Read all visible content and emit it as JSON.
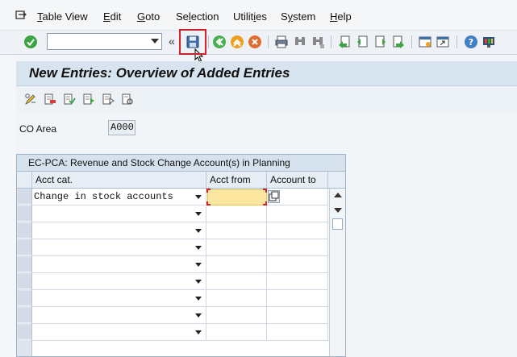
{
  "menu": {
    "items": [
      {
        "pre": "",
        "u": "T",
        "post": "able View"
      },
      {
        "pre": "",
        "u": "E",
        "post": "dit"
      },
      {
        "pre": "",
        "u": "G",
        "post": "oto"
      },
      {
        "pre": "Se",
        "u": "l",
        "post": "ection"
      },
      {
        "pre": "Utilit",
        "u": "i",
        "post": "es"
      },
      {
        "pre": "S",
        "u": "y",
        "post": "stem"
      },
      {
        "pre": "",
        "u": "H",
        "post": "elp"
      }
    ]
  },
  "toolbar": {
    "command_value": "",
    "nav_arrows": "«",
    "icons": [
      "check-icon",
      "save-icon",
      "back-icon",
      "exit-icon",
      "cancel-icon",
      "print-icon",
      "find-icon",
      "find-next-icon",
      "first-page-icon",
      "prev-page-icon",
      "next-page-icon",
      "last-page-icon",
      "create-session-icon",
      "shortcut-icon",
      "help-icon",
      "customize-icon"
    ]
  },
  "page": {
    "title": "New Entries: Overview of Added Entries"
  },
  "co_area": {
    "label": "CO Area",
    "value": "A000"
  },
  "table": {
    "title": "EC-PCA: Revenue and Stock Change Account(s) in Planning",
    "columns": [
      "Acct cat.",
      "Acct from",
      "Account to"
    ],
    "rows": [
      {
        "acct_cat": "Change in stock accounts",
        "acct_from": "",
        "acct_to": ""
      },
      {
        "acct_cat": "",
        "acct_from": "",
        "acct_to": ""
      },
      {
        "acct_cat": "",
        "acct_from": "",
        "acct_to": ""
      },
      {
        "acct_cat": "",
        "acct_from": "",
        "acct_to": ""
      },
      {
        "acct_cat": "",
        "acct_from": "",
        "acct_to": ""
      },
      {
        "acct_cat": "",
        "acct_from": "",
        "acct_to": ""
      },
      {
        "acct_cat": "",
        "acct_from": "",
        "acct_to": ""
      },
      {
        "acct_cat": "",
        "acct_from": "",
        "acct_to": ""
      },
      {
        "acct_cat": "",
        "acct_from": "",
        "acct_to": ""
      },
      {
        "acct_cat": "",
        "acct_from": "",
        "acct_to": ""
      }
    ]
  },
  "colors": {
    "accent": "#d0202a",
    "title_band": "#d7e3ef",
    "focus_cell": "#fde7a0"
  }
}
